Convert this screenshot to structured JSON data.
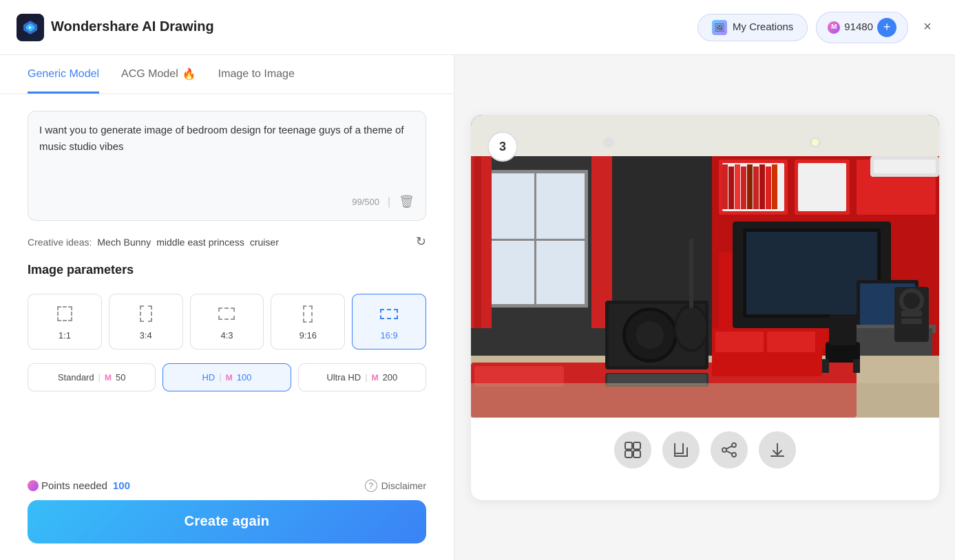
{
  "app": {
    "title": "Wondershare AI Drawing",
    "logo_alt": "Wondershare logo"
  },
  "header": {
    "my_creations_label": "My Creations",
    "points_value": "91480",
    "plus_label": "+",
    "close_label": "×"
  },
  "tabs": [
    {
      "id": "generic",
      "label": "Generic Model",
      "active": true,
      "fire": false
    },
    {
      "id": "acg",
      "label": "ACG Model",
      "active": false,
      "fire": true
    },
    {
      "id": "img2img",
      "label": "Image to Image",
      "active": false,
      "fire": false
    }
  ],
  "prompt": {
    "text": "I want you to generate image of  bedroom design for teenage guys of a theme of music studio vibes",
    "char_count": "99/500"
  },
  "creative_ideas": {
    "label": "Creative ideas:",
    "tags": [
      "Mech Bunny",
      "middle east princess",
      "cruiser"
    ]
  },
  "image_parameters": {
    "title": "Image parameters",
    "ratios": [
      {
        "id": "1-1",
        "label": "1:1",
        "active": false
      },
      {
        "id": "3-4",
        "label": "3:4",
        "active": false
      },
      {
        "id": "4-3",
        "label": "4:3",
        "active": false
      },
      {
        "id": "9-16",
        "label": "9:16",
        "active": false
      },
      {
        "id": "16-9",
        "label": "16:9",
        "active": true
      }
    ],
    "qualities": [
      {
        "id": "standard",
        "label": "Standard",
        "sep": "|",
        "m_label": "M",
        "points": "50",
        "active": false
      },
      {
        "id": "hd",
        "label": "HD",
        "sep": "|",
        "m_label": "M",
        "points": "100",
        "active": true
      },
      {
        "id": "ultra_hd",
        "label": "Ultra HD",
        "sep": "|",
        "m_label": "M",
        "points": "200",
        "active": false
      }
    ]
  },
  "bottom": {
    "points_label": "Points needed",
    "points_value": "100",
    "disclaimer_label": "Disclaimer",
    "create_again_label": "Create again"
  },
  "result": {
    "badge_number": "3",
    "actions": [
      {
        "id": "expand",
        "icon": "⊞",
        "label": "expand-icon"
      },
      {
        "id": "crop",
        "icon": "⊡",
        "label": "crop-icon"
      },
      {
        "id": "share",
        "icon": "⬡",
        "label": "share-icon"
      },
      {
        "id": "download",
        "icon": "⬇",
        "label": "download-icon"
      }
    ]
  }
}
